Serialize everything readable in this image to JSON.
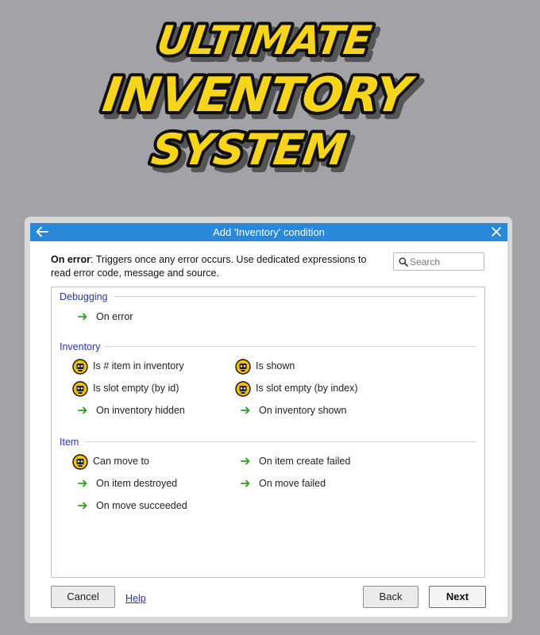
{
  "logo": {
    "line1": "ULTIMATE",
    "line2": "INVENTORY",
    "line3": "SYSTEM",
    "fill_color": "#f7d51d",
    "outline_color": "#111111",
    "shadow_color": "#555555"
  },
  "dialog": {
    "title": "Add 'Inventory' condition",
    "accent_color": "#2b88d9",
    "description_bold": "On error",
    "description_rest": ": Triggers once any error occurs. Use dedicated expressions to read error code, message and source.",
    "search_placeholder": "Search",
    "groups": {
      "debugging": {
        "name": "Debugging",
        "items": [
          "On error"
        ]
      },
      "inventory": {
        "name": "Inventory",
        "items": [
          "Is # item in inventory",
          "Is shown",
          "Is slot empty (by id)",
          "Is slot empty (by index)",
          "On inventory hidden",
          "On inventory shown"
        ]
      },
      "item": {
        "name": "Item",
        "items": [
          "Can move to",
          "On item create failed",
          "On item destroyed",
          "On move failed",
          "On move succeeded"
        ]
      }
    },
    "buttons": {
      "cancel": "Cancel",
      "help": "Help",
      "back": "Back",
      "next": "Next"
    }
  }
}
